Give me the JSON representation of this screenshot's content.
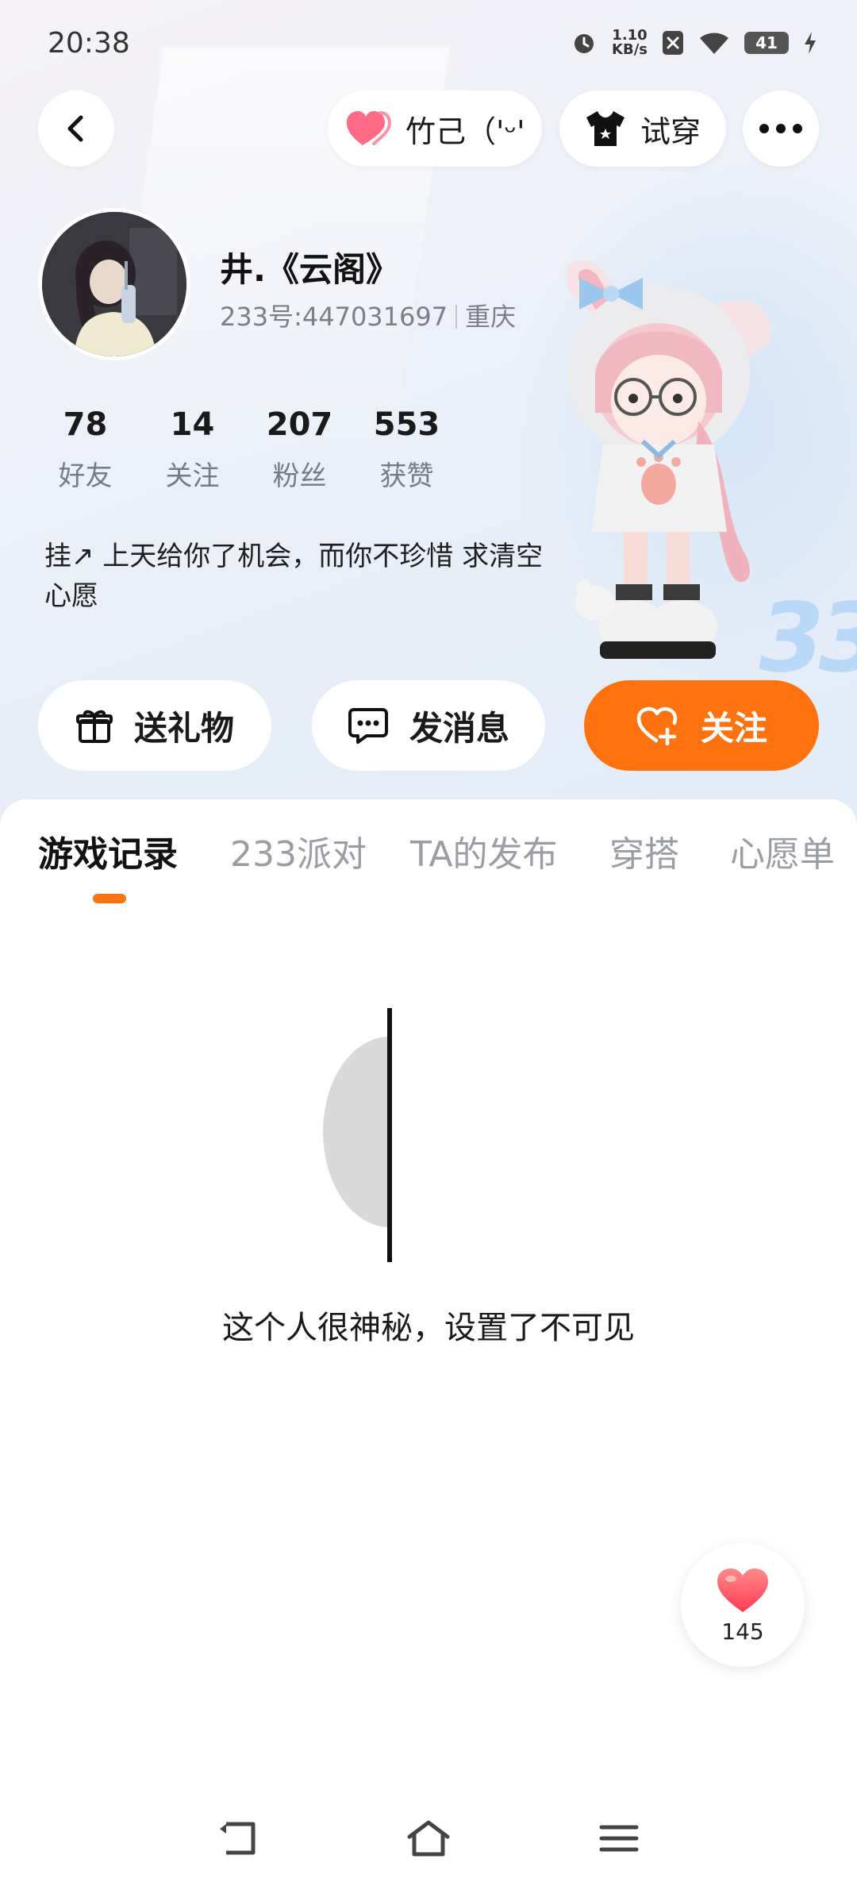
{
  "status_bar": {
    "time": "20:38",
    "speed_value": "1.10",
    "speed_unit": "KB/s",
    "battery": "41"
  },
  "header": {
    "nickname_pill": "竹己（'ᵕ'",
    "try_on_label": "试穿"
  },
  "profile": {
    "name": "井.《云阁》",
    "id_text": "233号:447031697",
    "location": "重庆",
    "bio": "挂↗  上天给你了机会，而你不珍惜   求清空心愿"
  },
  "stats": [
    {
      "value": "78",
      "label": "好友"
    },
    {
      "value": "14",
      "label": "关注"
    },
    {
      "value": "207",
      "label": "粉丝"
    },
    {
      "value": "553",
      "label": "获赞"
    }
  ],
  "actions": {
    "gift": "送礼物",
    "message": "发消息",
    "follow": "关注"
  },
  "tabs": [
    "游戏记录",
    "233派对",
    "TA的发布",
    "穿搭",
    "心愿单"
  ],
  "active_tab": 0,
  "empty_state": {
    "text": "这个人很神秘，设置了不可见"
  },
  "like": {
    "count": "145"
  },
  "colors": {
    "accent": "#ff7210",
    "like": "#ff5a6e"
  },
  "icons": {
    "back": "back-arrow-icon",
    "heart": "heart-icon",
    "shirt": "tshirt-icon",
    "more": "more-dots-icon",
    "gift": "gift-icon",
    "chat": "chat-bubble-icon",
    "follow": "heart-plus-icon"
  }
}
